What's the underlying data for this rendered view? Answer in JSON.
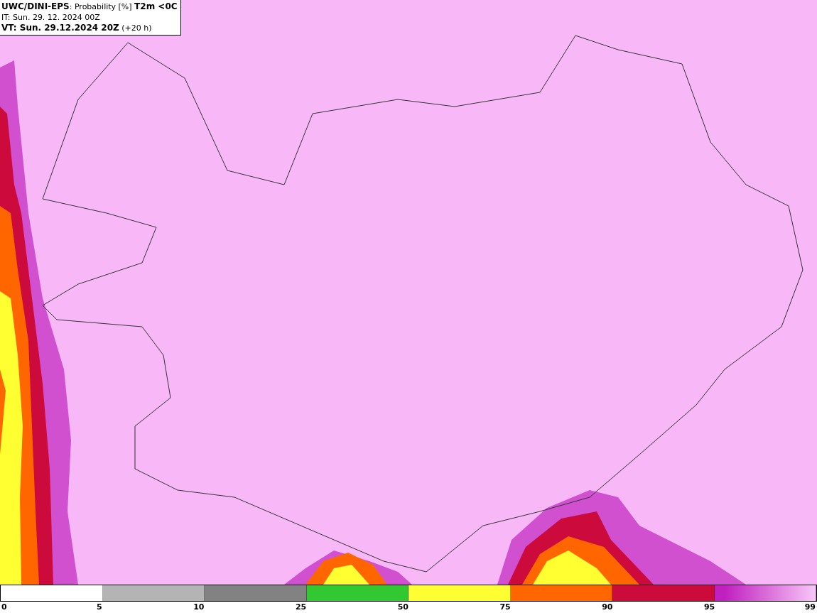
{
  "header": {
    "lines": [
      "**UWC/DINI-EPS**: Probability [%] **T2m <0C**",
      "IT: Sun. 29. 12. 2024 00Z",
      "**VT: Sun. 29.12.2024 20Z** (+20 h)"
    ]
  },
  "legend": {
    "start_label": "0",
    "bins": [
      {
        "kind": "solid",
        "color": "#ffffff",
        "label": "5"
      },
      {
        "kind": "solid",
        "color": "#b4b4b4",
        "label": "10"
      },
      {
        "kind": "solid",
        "color": "#828282",
        "label": "25"
      },
      {
        "kind": "solid",
        "color": "#32c832",
        "label": "50"
      },
      {
        "kind": "solid",
        "color": "#ffff32",
        "label": "75"
      },
      {
        "kind": "solid",
        "color": "#ff6600",
        "label": "90"
      },
      {
        "kind": "solid",
        "color": "#cc0a3c",
        "label": "95"
      },
      {
        "kind": "gradient",
        "color": "#c020c0",
        "label": "99"
      }
    ]
  }
}
